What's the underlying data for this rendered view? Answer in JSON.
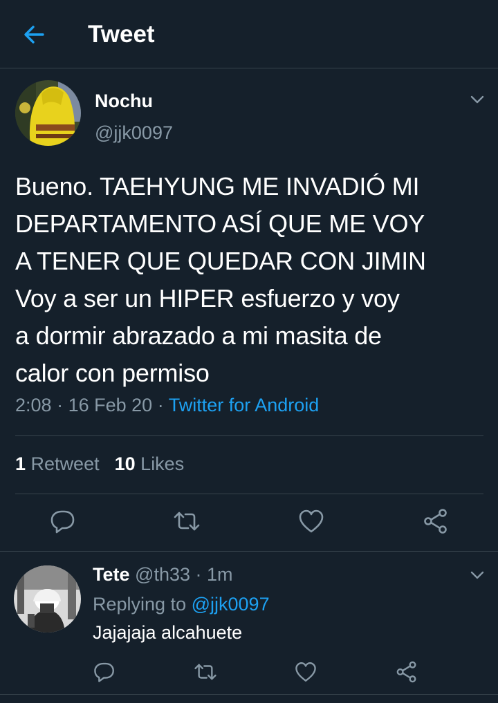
{
  "header": {
    "title": "Tweet",
    "back_icon": "arrow-left-icon"
  },
  "colors": {
    "background": "#15202b",
    "accent": "#1da1f2",
    "muted": "#8899a6",
    "border": "#38444d"
  },
  "tweet": {
    "author_name": "Nochu",
    "author_handle": "@jjk0097",
    "text": "Bueno. TAEHYUNG ME INVADIÓ MI\nDEPARTAMENTO ASÍ QUE ME VOY\nA TENER QUE QUEDAR CON JIMIN\nVoy a ser un HIPER esfuerzo y voy\na dormir abrazado a mi masita de\ncalor con permiso",
    "time": "2:08",
    "date": "16 Feb 20",
    "source": "Twitter for Android",
    "retweet_count": "1",
    "retweet_label": "Retweet",
    "like_count": "10",
    "like_label": "Likes",
    "actions": [
      "reply-icon",
      "retweet-icon",
      "like-icon",
      "share-icon"
    ]
  },
  "reply": {
    "author_name": "Tete",
    "author_handle": "@th33",
    "age": "1m",
    "replying_prefix": "Replying to",
    "replying_to": "@jjk0097",
    "text": "Jajajaja alcahuete"
  }
}
